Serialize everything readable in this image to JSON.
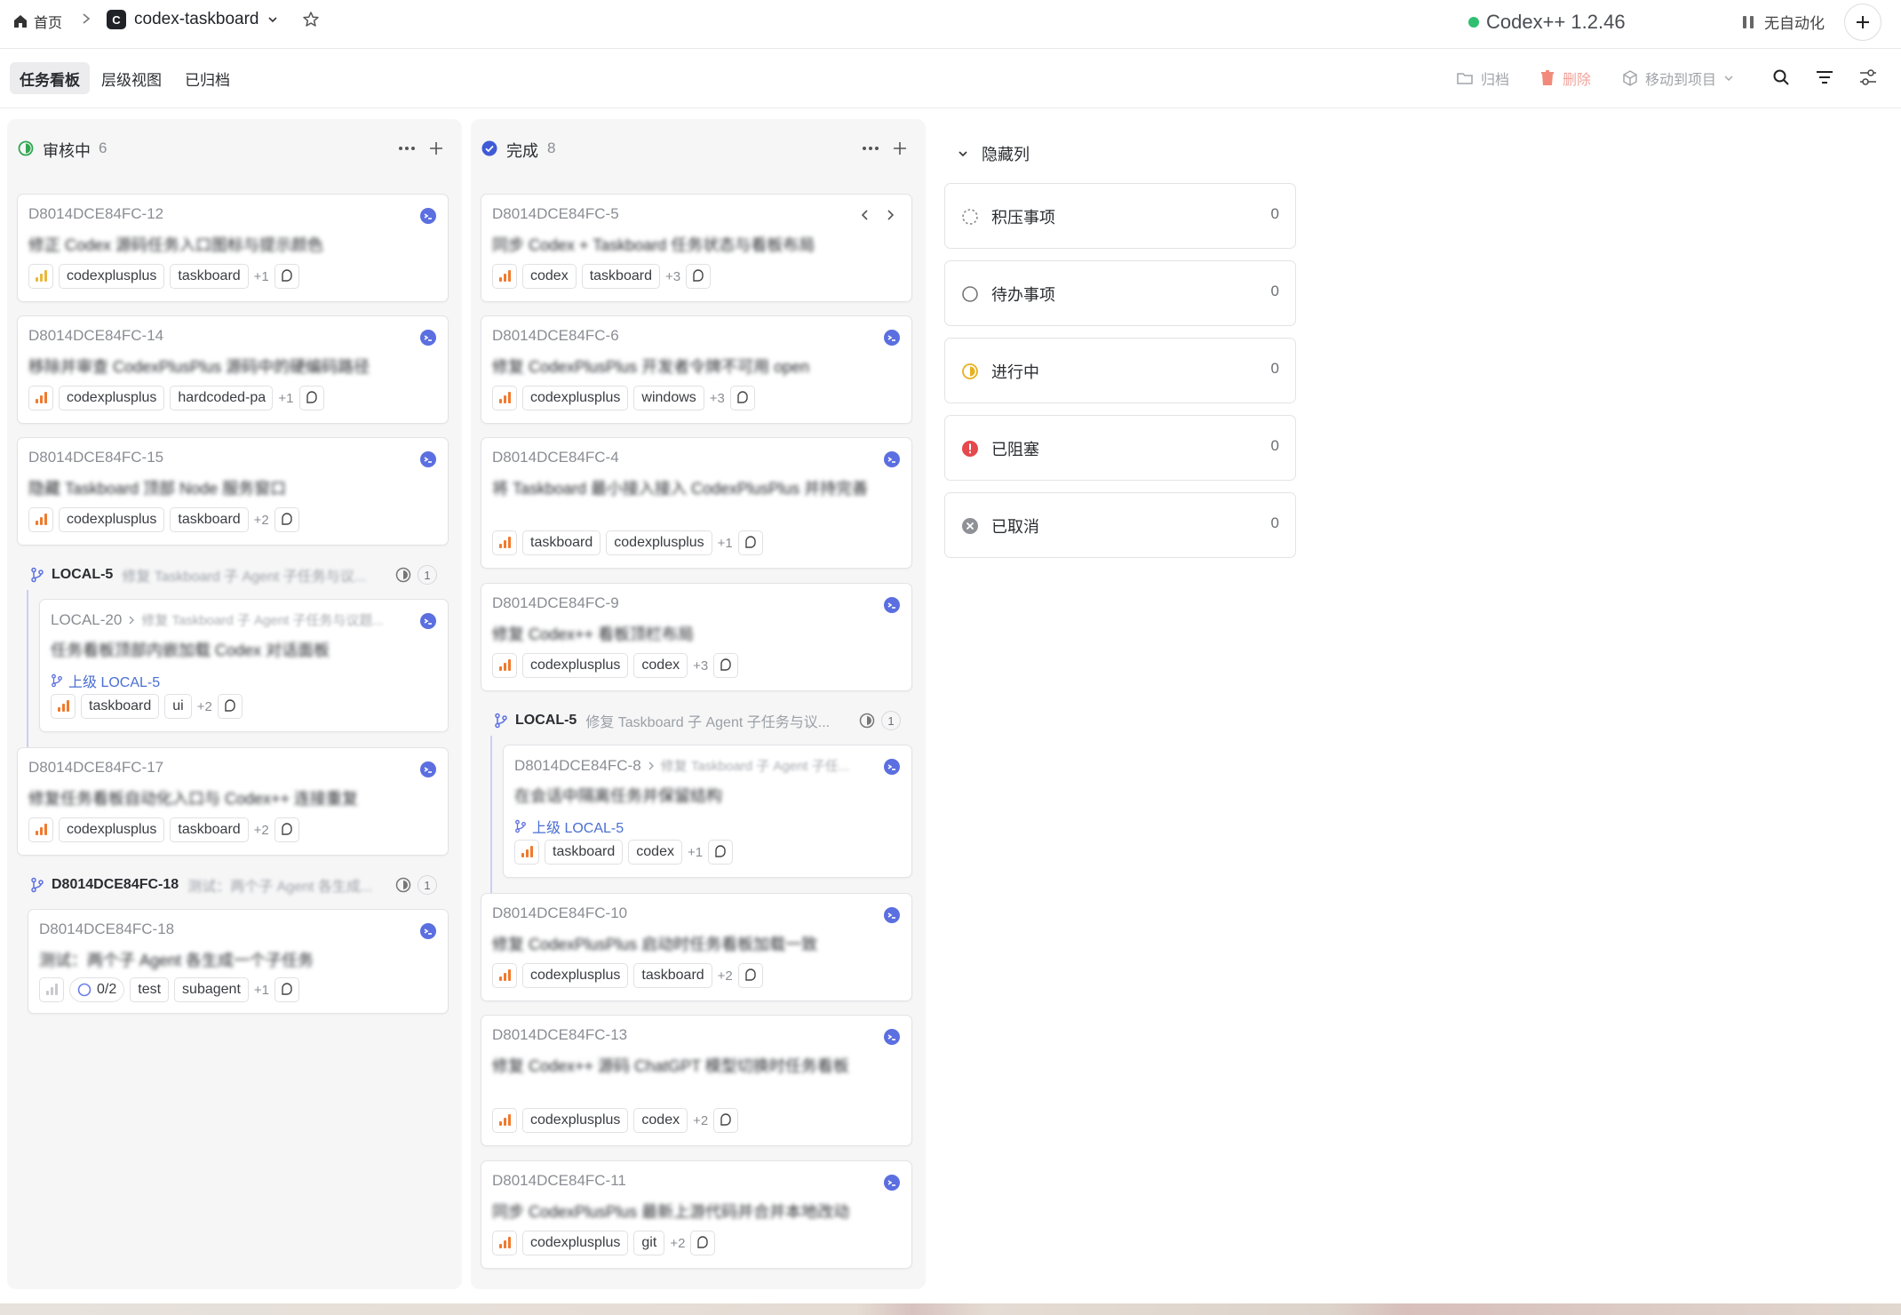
{
  "topbar": {
    "home_label": "首页",
    "project_letter": "C",
    "project_name": "codex-taskboard",
    "app_status": "Codex++ 1.2.46",
    "automation_label": "无自动化"
  },
  "toolbar": {
    "tabs": [
      {
        "label": "任务看板"
      },
      {
        "label": "层级视图"
      },
      {
        "label": "已归档"
      }
    ],
    "archive_label": "归档",
    "delete_label": "删除",
    "move_label": "移动到项目"
  },
  "columns": [
    {
      "name": "审核中",
      "count": "6",
      "cards": [
        {
          "id": "D8014DCE84FC-12",
          "title": "修正 Codex 源码任务入口图标与提示颜色",
          "tags": [
            "codexplusplus",
            "taskboard"
          ],
          "more": "+1"
        },
        {
          "id": "D8014DCE84FC-14",
          "title": "移除并审查 CodexPlusPlus 源码中的硬编码路径",
          "tags": [
            "codexplusplus",
            "hardcoded-pa"
          ],
          "more": "+1"
        },
        {
          "id": "D8014DCE84FC-15",
          "title": "隐藏 Taskboard 顶部 Node 服务窗口",
          "tags": [
            "codexplusplus",
            "taskboard"
          ],
          "more": "+2"
        }
      ],
      "group1": {
        "id": "LOCAL-5",
        "title": "修复 Taskboard 子 Agent 子任务与议...",
        "count": "1",
        "card": {
          "id": "LOCAL-20",
          "crumb": "修复 Taskboard 子 Agent 子任务与议题...",
          "title": "任务看板顶部内嵌加载 Codex 对话面板",
          "parent": "上级 LOCAL-5",
          "tags": [
            "taskboard",
            "ui"
          ],
          "more": "+2"
        }
      },
      "card4": {
        "id": "D8014DCE84FC-17",
        "title": "修复任务看板自动化入口与 Codex++ 连接重复",
        "tags": [
          "codexplusplus",
          "taskboard"
        ],
        "more": "+2"
      },
      "group2": {
        "id": "D8014DCE84FC-18",
        "title": "测试：两个子 Agent 各生成...",
        "count": "1",
        "card": {
          "id": "D8014DCE84FC-18",
          "title": "测试：两个子 Agent 各生成一个子任务",
          "progress": "0/2",
          "tags": [
            "test",
            "subagent"
          ],
          "more": "+1"
        }
      }
    },
    {
      "name": "完成",
      "count": "8",
      "cards": [
        {
          "id": "D8014DCE84FC-5",
          "title": "同步 Codex + Taskboard 任务状态与看板布局",
          "tags": [
            "codex",
            "taskboard"
          ],
          "more": "+3"
        },
        {
          "id": "D8014DCE84FC-6",
          "title": "修复 CodexPlusPlus 开发者令牌不可用 open",
          "tags": [
            "codexplusplus",
            "windows"
          ],
          "more": "+3"
        },
        {
          "id": "D8014DCE84FC-4",
          "title": "将 Taskboard 最小接入接入 CodexPlusPlus 并持完善",
          "tags": [
            "taskboard",
            "codexplusplus"
          ],
          "more": "+1"
        },
        {
          "id": "D8014DCE84FC-9",
          "title": "修复 Codex++ 看板顶栏布局",
          "tags": [
            "codexplusplus",
            "codex"
          ],
          "more": "+3"
        }
      ],
      "group": {
        "id": "LOCAL-5",
        "title": "修复 Taskboard 子 Agent 子任务与议...",
        "count": "1",
        "card": {
          "id": "D8014DCE84FC-8",
          "crumb": "修复 Taskboard 子 Agent 子任...",
          "title": "在会话中隔离任务并保留结构",
          "parent": "上级 LOCAL-5",
          "tags": [
            "taskboard",
            "codex"
          ],
          "more": "+1"
        }
      },
      "cards2": [
        {
          "id": "D8014DCE84FC-10",
          "title": "修复 CodexPlusPlus 启动时任务看板加载一致",
          "tags": [
            "codexplusplus",
            "taskboard"
          ],
          "more": "+2"
        },
        {
          "id": "D8014DCE84FC-13",
          "title": "修复 Codex++ 源码 ChatGPT 模型切换时任务看板",
          "tags": [
            "codexplusplus",
            "codex"
          ],
          "more": "+2"
        },
        {
          "id": "D8014DCE84FC-11",
          "title": "同步 CodexPlusPlus 最新上游代码并合并本地改动",
          "tags": [
            "codexplusplus",
            "git"
          ],
          "more": "+2"
        }
      ]
    }
  ],
  "hidden": {
    "title": "隐藏列",
    "items": [
      {
        "label": "积压事项",
        "count": "0"
      },
      {
        "label": "待办事项",
        "count": "0"
      },
      {
        "label": "进行中",
        "count": "0"
      },
      {
        "label": "已阻塞",
        "count": "0"
      },
      {
        "label": "已取消",
        "count": "0"
      }
    ]
  },
  "colors": {
    "accent": "#3f5bd6",
    "priority": "#f07a2d",
    "done": "#3f5bd6",
    "review": "#2fa84f",
    "status_dot": "#2fbf71"
  }
}
